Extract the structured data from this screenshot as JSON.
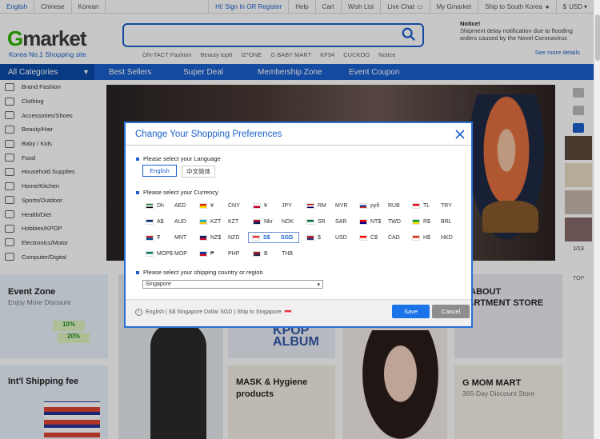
{
  "topbar": {
    "languages": [
      "English",
      "Chinese",
      "Korean"
    ],
    "links": [
      "Hi! Sign In OR Register",
      "Help",
      "Cart",
      "Wish List",
      "Live Chat",
      "My Gmarket",
      "Ship to South Korea",
      "USD"
    ]
  },
  "header": {
    "logo": "Gmarket",
    "slogan": "Korea No.1 Shopping site",
    "keywords": [
      "ON-TACT Fashion",
      "Beauty top6",
      "IZ*ONE",
      "G BABY MART",
      "KF94",
      "CUCKOO",
      "Notice"
    ],
    "notice_title": "Notice!",
    "notice_text": "Shipment delay notification due to flooding orders caused by the Novel Coronavirus",
    "notice_more": "See more details"
  },
  "nav": {
    "categories": "All Categories",
    "items": [
      "Best Sellers",
      "Super Deal",
      "Membership Zone",
      "Event Coupon"
    ]
  },
  "sidebar": {
    "items": [
      "Brand Fashion",
      "Clothing",
      "Accessories/Shoes",
      "Beauty/Hair",
      "Baby / Kids",
      "Food",
      "Household Supplies",
      "Home/Kitchen",
      "Sports/Outdoor",
      "Health/Diet",
      "Hobbies/KPOP",
      "Electronics/Motor",
      "Computer/Digital"
    ]
  },
  "rail": {
    "page": "1/13",
    "top": "TOP"
  },
  "tiles": {
    "event_zone": {
      "title": "Event Zone",
      "sub": "Enjoy More Discount",
      "badge1": "10%",
      "badge2": "20%"
    },
    "dept_store": {
      "title": "L ABOUT",
      "title2": "PARTMENT STORE"
    },
    "intl_shipping": {
      "title": "Int'l Shipping fee"
    },
    "mask": {
      "title": "MASK & Hygiene",
      "title2": "products"
    },
    "kpop": {
      "title": "KPOP",
      "title2": "ALBUM"
    },
    "gmom": {
      "title": "G MOM MART",
      "sub": "365-Day Discount Store"
    }
  },
  "modal": {
    "title": "Change Your Shopping Preferences",
    "lang_label": "Please select your Language",
    "languages": [
      "English",
      "中文简体"
    ],
    "currency_label": "Please select your Currency",
    "currencies": [
      {
        "sym": "Dh",
        "code": "AED",
        "colors": [
          "#00732f",
          "#ffffff",
          "#000000"
        ]
      },
      {
        "sym": "¥",
        "code": "CNY",
        "colors": [
          "#de2910",
          "#ffde00"
        ]
      },
      {
        "sym": "¥",
        "code": "JPY",
        "colors": [
          "#ffffff",
          "#bc002d"
        ]
      },
      {
        "sym": "RM",
        "code": "MYR",
        "colors": [
          "#cc0001",
          "#ffffff",
          "#010066"
        ]
      },
      {
        "sym": "руб",
        "code": "RUB",
        "colors": [
          "#ffffff",
          "#0039a6",
          "#d52b1e"
        ]
      },
      {
        "sym": "TL",
        "code": "TRY",
        "colors": [
          "#e30a17",
          "#ffffff"
        ]
      },
      {
        "sym": "A$",
        "code": "AUD",
        "colors": [
          "#012169",
          "#ffffff"
        ]
      },
      {
        "sym": "KZT",
        "code": "KZT",
        "colors": [
          "#00afca",
          "#fec50c"
        ]
      },
      {
        "sym": "Nkr",
        "code": "NOK",
        "colors": [
          "#ba0c2f",
          "#00205b"
        ]
      },
      {
        "sym": "SR",
        "code": "SAR",
        "colors": [
          "#006c35",
          "#ffffff"
        ]
      },
      {
        "sym": "NT$",
        "code": "TWD",
        "colors": [
          "#fe0000",
          "#000095"
        ]
      },
      {
        "sym": "R$",
        "code": "BRL",
        "colors": [
          "#009c3b",
          "#ffdf00"
        ]
      },
      {
        "sym": "₮",
        "code": "MNT",
        "colors": [
          "#c4272f",
          "#015197"
        ]
      },
      {
        "sym": "NZ$",
        "code": "NZD",
        "colors": [
          "#012169",
          "#c8102e"
        ]
      },
      {
        "sym": "S$",
        "code": "SGD",
        "colors": [
          "#ef3340",
          "#ffffff"
        ]
      },
      {
        "sym": "$",
        "code": "USD",
        "colors": [
          "#b22234",
          "#3c3b6e"
        ]
      },
      {
        "sym": "C$",
        "code": "CAD",
        "colors": [
          "#ff0000",
          "#ffffff"
        ]
      },
      {
        "sym": "H$",
        "code": "HKD",
        "colors": [
          "#de2910",
          "#ffffff"
        ]
      },
      {
        "sym": "MOP$",
        "code": "MOP",
        "colors": [
          "#00785e",
          "#ffffff"
        ]
      },
      {
        "sym": "₱",
        "code": "PHP",
        "colors": [
          "#0038a8",
          "#ce1126"
        ]
      },
      {
        "sym": "B",
        "code": "THB",
        "colors": [
          "#a51931",
          "#2d2a4a"
        ]
      }
    ],
    "country_label": "Please select your shipping country or region",
    "country_value": "Singapore",
    "summary": "English | S$ Singapore Dollar SGD | Ship to Singapore",
    "save": "Save",
    "cancel": "Cancel"
  }
}
